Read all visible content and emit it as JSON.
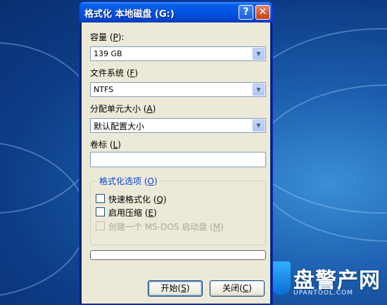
{
  "window": {
    "title": "格式化 本地磁盘 (G:)",
    "help_glyph": "?",
    "close_glyph": "✕"
  },
  "capacity": {
    "label_pre": "容量 (",
    "label_key": "P",
    "label_post": "):",
    "value": "139 GB"
  },
  "filesystem": {
    "label_pre": "文件系统 (",
    "label_key": "F",
    "label_post": ")",
    "value": "NTFS"
  },
  "allocation": {
    "label_pre": "分配单元大小 (",
    "label_key": "A",
    "label_post": ")",
    "value": "默认配置大小"
  },
  "volume_label": {
    "label_pre": "卷标 (",
    "label_key": "L",
    "label_post": ")",
    "value": ""
  },
  "options": {
    "legend_pre": "格式化选项 (",
    "legend_key": "O",
    "legend_post": ")",
    "quick": {
      "label_pre": "快速格式化 (",
      "label_key": "Q",
      "label_post": ")",
      "checked": false
    },
    "compress": {
      "label_pre": "启用压缩 (",
      "label_key": "E",
      "label_post": ")",
      "checked": false
    },
    "msdos": {
      "label_pre": "创建一个 MS-DOS 启动盘 (",
      "label_key": "M",
      "label_post": ")",
      "checked": false,
      "enabled": false
    }
  },
  "progress": {
    "fraction": 0
  },
  "buttons": {
    "start": {
      "pre": "开始(",
      "key": "S",
      "post": ")"
    },
    "close": {
      "pre": "关闭(",
      "key": "C",
      "post": ")"
    }
  },
  "watermark": {
    "brand": "盘警产网",
    "sub": "UPANTOOL.COM"
  },
  "colors": {
    "titlebar": "#0054e3",
    "dialog_bg": "#ece9d8",
    "group_legend": "#0046d5",
    "desktop": "#1c5fae"
  }
}
